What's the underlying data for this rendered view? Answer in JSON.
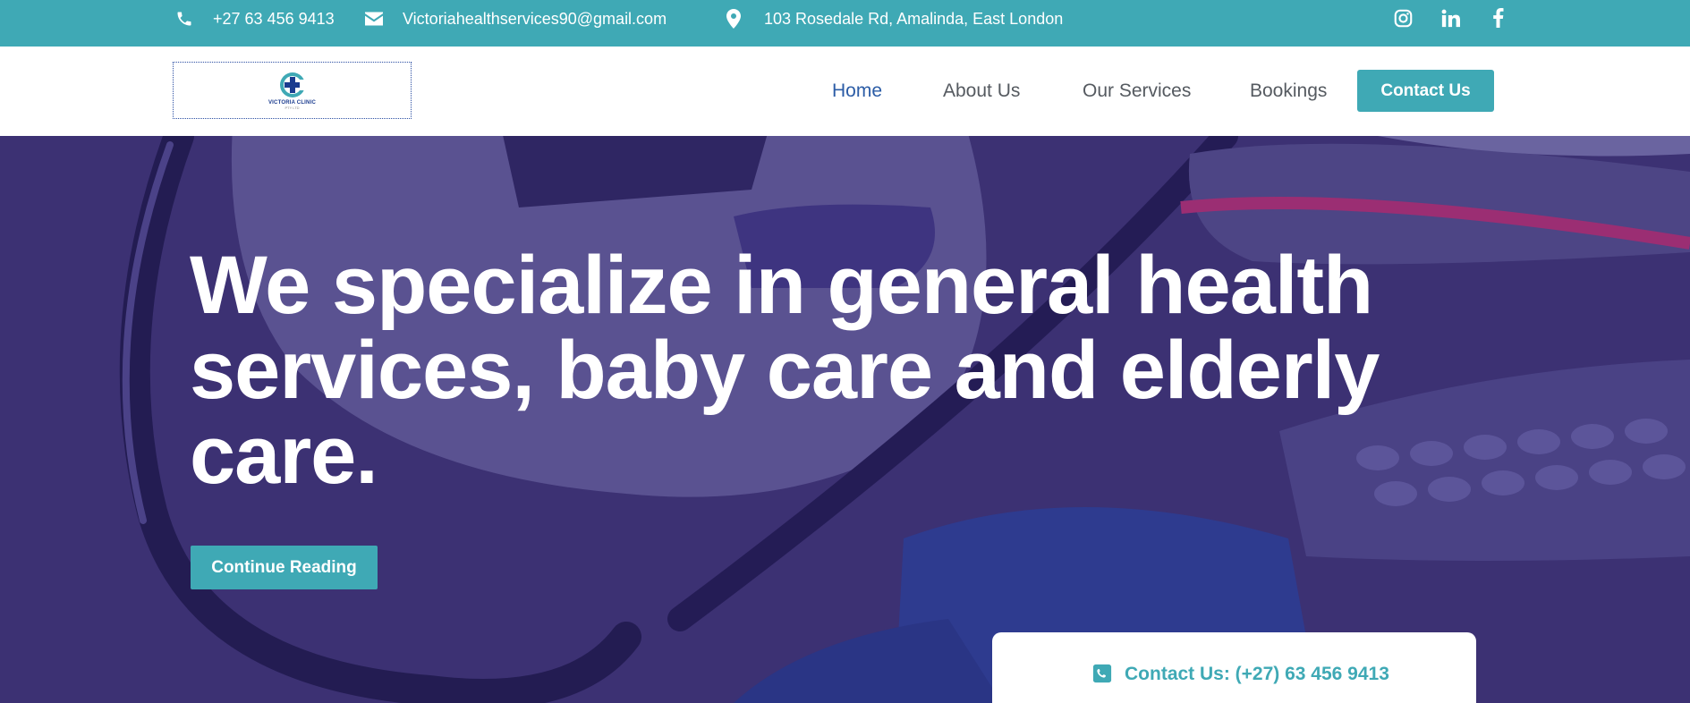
{
  "topbar": {
    "phone": "+27 63 456 9413",
    "email": "Victoriahealthservices90@gmail.com",
    "address": "103 Rosedale Rd, Amalinda, East London",
    "icons": [
      "phone-icon",
      "mail-icon",
      "location-pin-icon",
      "instagram-icon",
      "linkedin-icon",
      "facebook-icon"
    ]
  },
  "logo": {
    "name": "VICTORIA CLINIC",
    "sub": "PTY LTD"
  },
  "nav": {
    "items": [
      "Home",
      "About Us",
      "Our Services",
      "Bookings"
    ],
    "active": "Home",
    "cta": "Contact Us"
  },
  "hero": {
    "heading": "We specialize in general health services, baby care and elderly care.",
    "button": "Continue Reading"
  },
  "contact_card": {
    "label": "Contact Us: (+27) 63 456 9413"
  },
  "colors": {
    "accent": "#3fa9b5",
    "hero_overlay": "#3b3072",
    "active_link": "#2b5ca6"
  }
}
